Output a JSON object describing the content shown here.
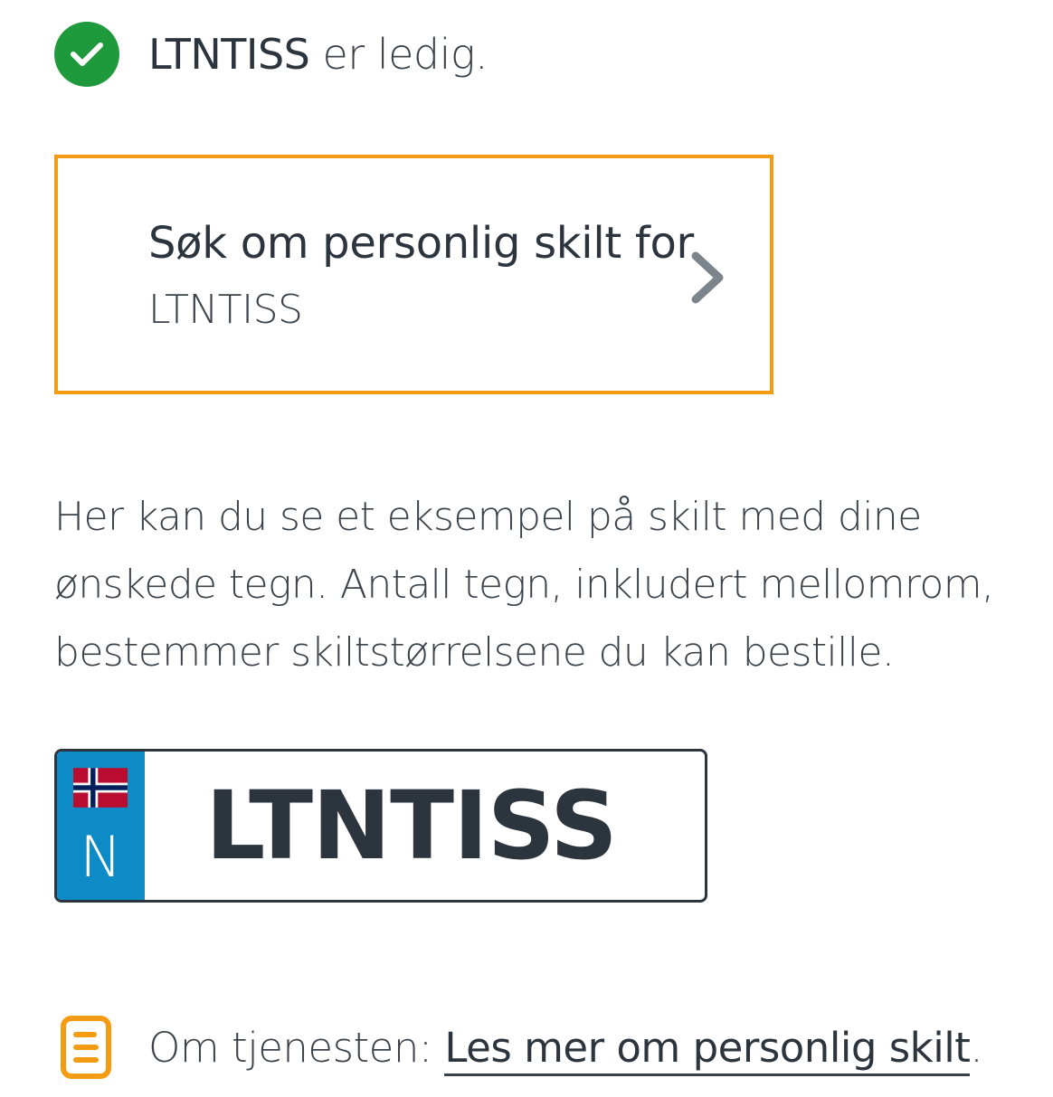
{
  "status": {
    "plate_name": "LTNTISS",
    "text": " er ledig.",
    "icon": "check-circle-icon",
    "color": "#1e9a3c"
  },
  "apply_card": {
    "title": "Søk om personlig skilt for",
    "subtitle": "LTNTISS",
    "icon": "chevron-right-icon",
    "border_color": "#f39c12"
  },
  "description": "Her kan du se et eksempel på skilt med dine ønskede tegn. Antall tegn, inkludert mellomrom, bestemmer skiltstørrelsene du kan bestille.",
  "plate": {
    "country_code": "N",
    "characters": "LTNTISS",
    "band_color": "#0d8bc6",
    "flag_icon": "norway-flag-icon"
  },
  "info": {
    "icon": "document-icon",
    "icon_color": "#f39c12",
    "prefix": "Om tjenesten: ",
    "link_text": "Les mer om personlig skilt",
    "suffix": "."
  }
}
